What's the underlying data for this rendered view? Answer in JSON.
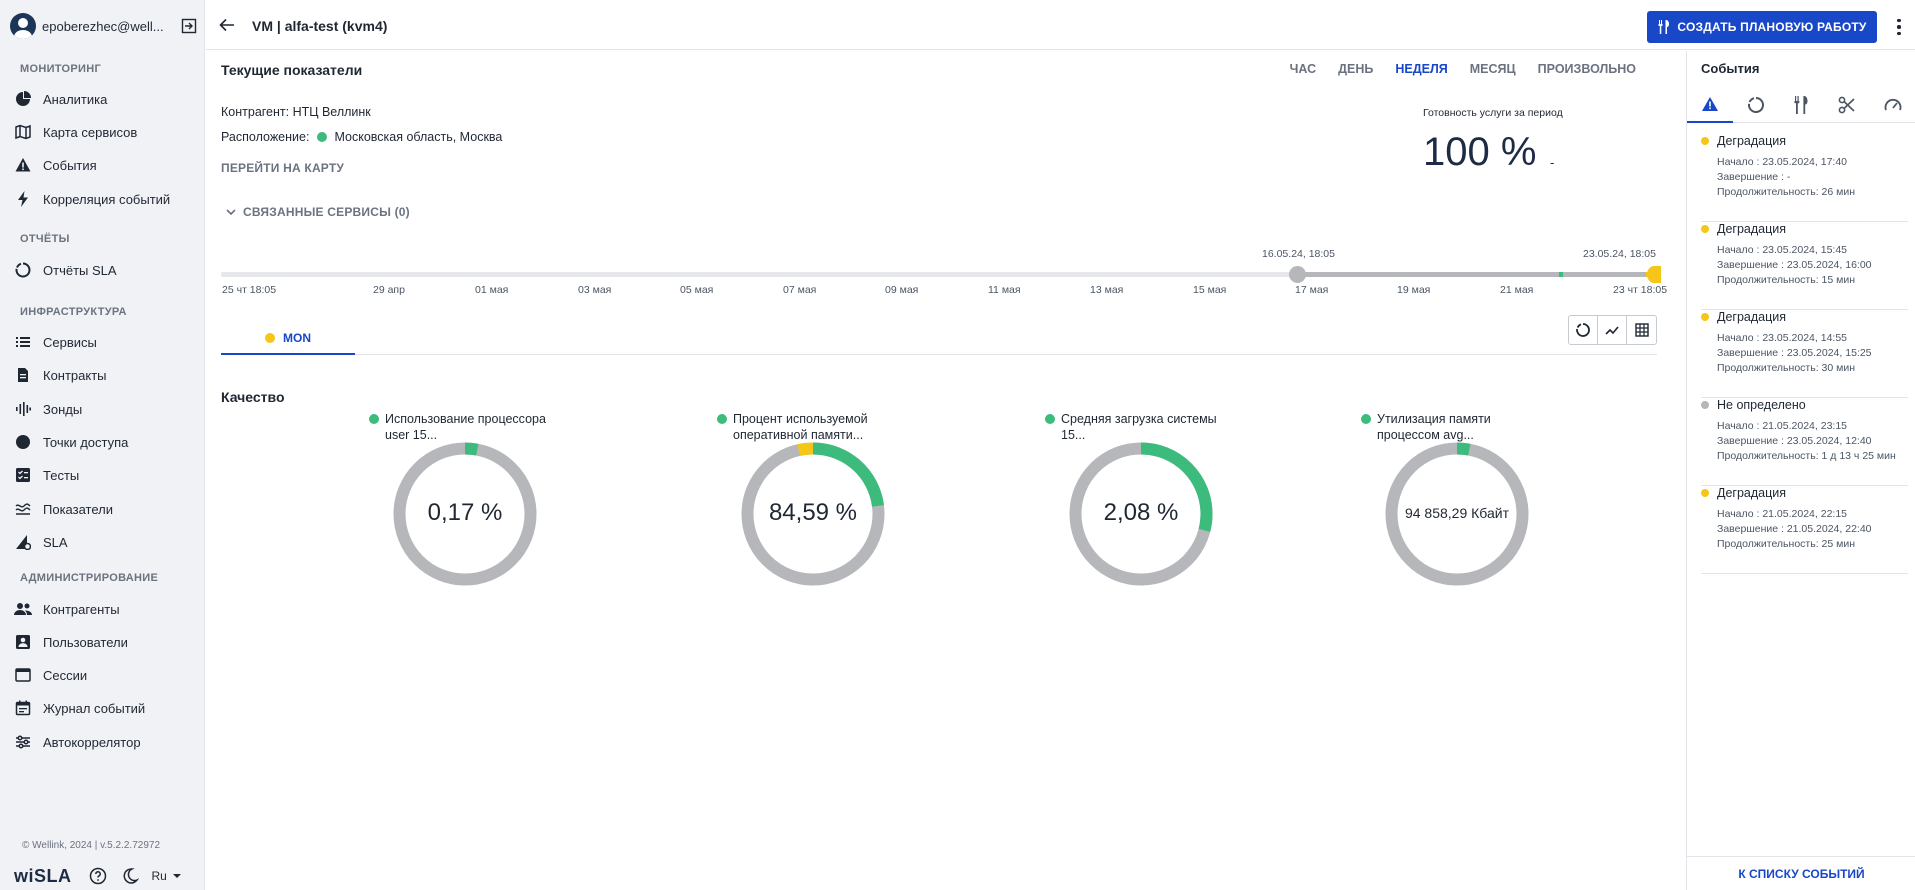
{
  "sidebar": {
    "user_name": "epoberezhec@well...",
    "sections": {
      "monitoring": "МОНИТОРИНГ",
      "reports": "ОТЧЁТЫ",
      "infrastructure": "ИНФРАСТРУКТУРА",
      "administration": "АДМИНИСТРИРОВАНИЕ"
    },
    "items": {
      "analytics": "Аналитика",
      "service_map": "Карта сервисов",
      "events": "События",
      "correlation": "Корреляция событий",
      "sla_reports": "Отчёты SLA",
      "services": "Сервисы",
      "contracts": "Контракты",
      "probes": "Зонды",
      "access_points": "Точки доступа",
      "tests": "Тесты",
      "indicators": "Показатели",
      "sla": "SLA",
      "counterparties": "Контрагенты",
      "users": "Пользователи",
      "sessions": "Сессии",
      "event_log": "Журнал событий",
      "autocorrelator": "Автокоррелятор"
    },
    "copyright": "© Wellink, 2024 | v.5.2.2.72972",
    "brand": "wiSLA",
    "language": "Ru"
  },
  "header": {
    "title": "VM | alfa-test (kvm4)",
    "create_button": "СОЗДАТЬ ПЛАНОВУЮ РАБОТУ"
  },
  "main": {
    "section_title": "Текущие показатели",
    "period_tabs": [
      "ЧАС",
      "ДЕНЬ",
      "НЕДЕЛЯ",
      "МЕСЯЦ",
      "ПРОИЗВОЛЬНО"
    ],
    "active_period": "НЕДЕЛЯ",
    "counterparty": "Контрагент: НТЦ Веллинк",
    "location_label": "Расположение:",
    "location_value": "Московская область, Москва",
    "map_link": "ПЕРЕЙТИ НА КАРТУ",
    "availability_label": "Готовность услуги за период",
    "availability_value": "100 %",
    "availability_delta": "-",
    "related_services": "СВЯЗАННЫЕ СЕРВИСЫ (0)",
    "timeline": {
      "range_start_label": "16.05.24, 18:05",
      "range_end_label": "23.05.24, 18:05",
      "ticks": [
        "25 чт 18:05",
        "29 апр",
        "01 мая",
        "03 мая",
        "05 мая",
        "07 мая",
        "09 мая",
        "11 мая",
        "13 мая",
        "15 мая",
        "17 мая",
        "19 мая",
        "21 мая",
        "23 чт 18:05"
      ]
    },
    "probe_tab": "MON",
    "quality_title": "Качество",
    "gauges": [
      {
        "title_line1": "Использование процессора",
        "title_line2": "user 15...",
        "value": "0,17 %",
        "fill_fraction": 0.03,
        "secondary_fraction": 0
      },
      {
        "title_line1": "Процент используемой",
        "title_line2": "оперативной памяти...",
        "value": "84,59 %",
        "fill_fraction": 0.23,
        "secondary_fraction": 0.035
      },
      {
        "title_line1": "Средняя загрузка системы",
        "title_line2": "15...",
        "value": "2,08 %",
        "fill_fraction": 0.29,
        "secondary_fraction": 0
      },
      {
        "title_line1": "Утилизация памяти",
        "title_line2": "процессом avg...",
        "value": "94 858,29 Кбайт",
        "fill_fraction": 0.03,
        "secondary_fraction": 0
      }
    ]
  },
  "events": {
    "title": "События",
    "items": [
      {
        "status": "Деградация",
        "color": "#f5c518",
        "start": "Начало : 23.05.2024, 17:40",
        "end": "Завершение : -",
        "duration": "Продолжительность: 26 мин"
      },
      {
        "status": "Деградация",
        "color": "#f5c518",
        "start": "Начало : 23.05.2024, 15:45",
        "end": "Завершение : 23.05.2024, 16:00",
        "duration": "Продолжительность: 15 мин"
      },
      {
        "status": "Деградация",
        "color": "#f5c518",
        "start": "Начало : 23.05.2024, 14:55",
        "end": "Завершение : 23.05.2024, 15:25",
        "duration": "Продолжительность: 30 мин"
      },
      {
        "status": "Не определено",
        "color": "#b5b7bb",
        "start": "Начало : 21.05.2024, 23:15",
        "end": "Завершение : 23.05.2024, 12:40",
        "duration": "Продолжительность: 1 д 13 ч 25 мин"
      },
      {
        "status": "Деградация",
        "color": "#f5c518",
        "start": "Начало : 21.05.2024, 22:15",
        "end": "Завершение : 21.05.2024, 22:40",
        "duration": "Продолжительность: 25 мин"
      }
    ],
    "list_link": "К СПИСКУ СОБЫТИЙ"
  },
  "colors": {
    "accent": "#1847c7",
    "ok": "#3dbb7c",
    "warning": "#f5c518",
    "neutral": "#b5b7bb"
  }
}
